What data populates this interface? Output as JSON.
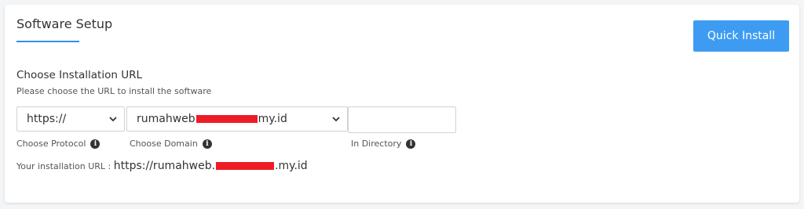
{
  "header": {
    "title": "Software Setup",
    "quick_install_label": "Quick Install",
    "accent_color": "#3d9cf2"
  },
  "installation_url": {
    "heading": "Choose Installation URL",
    "description": "Please choose the URL to install the software",
    "protocol": {
      "selected": "https://",
      "label": "Choose Protocol"
    },
    "domain": {
      "selected_prefix": "rumahweb",
      "selected_suffix": "my.id",
      "label": "Choose Domain"
    },
    "directory": {
      "value": "",
      "label": "In Directory"
    },
    "result": {
      "label": "Your installation URL :",
      "url_prefix": "https://rumahweb.",
      "url_suffix": ".my.id"
    }
  },
  "icons": {
    "info": "info-icon",
    "dropdown": "chevron-down-icon"
  },
  "redaction_color": "#ee1c25"
}
